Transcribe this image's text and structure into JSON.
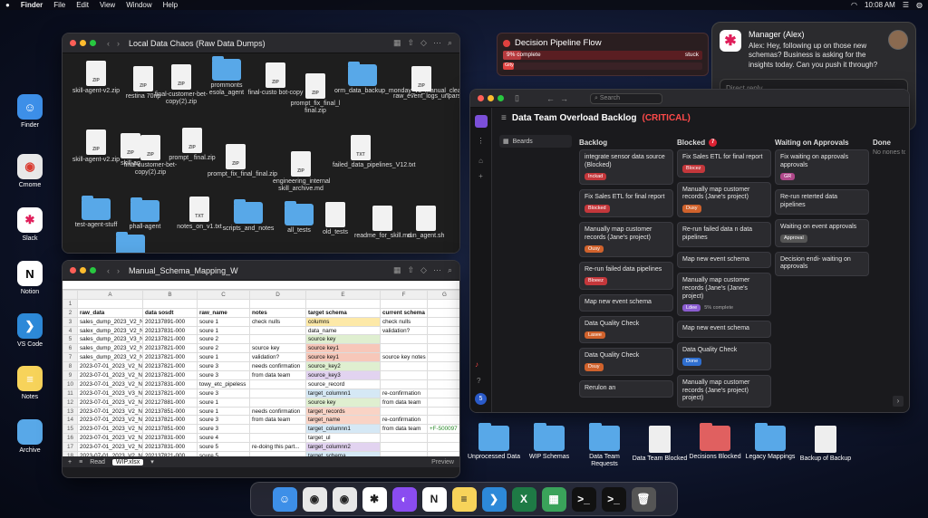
{
  "menubar": {
    "app": "Finder",
    "items": [
      "File",
      "Edit",
      "View",
      "Window",
      "Help"
    ],
    "clock": "10:08 AM"
  },
  "left_dock": [
    {
      "label": "Finder",
      "icon": "finder-icon",
      "color": "#3d8fe8"
    },
    {
      "label": "Cmome",
      "icon": "chrome-icon",
      "color": "#e8e8e8"
    },
    {
      "label": "Slack",
      "icon": "slack-icon",
      "color": "#ffffff"
    },
    {
      "label": "Notion",
      "icon": "notion-icon",
      "color": "#ffffff"
    },
    {
      "label": "VS Code",
      "icon": "vscode-icon",
      "color": "#2d89d8"
    },
    {
      "label": "Notes",
      "icon": "notes-icon",
      "color": "#f7d35a"
    },
    {
      "label": "Archive",
      "icon": "folder-icon",
      "color": "#58a8e8"
    }
  ],
  "finder": {
    "title": "Local Data Chaos (Raw Data Dumps)",
    "items": [
      {
        "label": "skill-agent-v2.zip",
        "kind": "zip"
      },
      {
        "label": "restina 70np",
        "kind": "zip"
      },
      {
        "label": "final-customer-bet-copy(2).zip",
        "kind": "zip"
      },
      {
        "label": "prommonts esola_agent",
        "kind": "folder"
      },
      {
        "label": "final-custo bot-copy",
        "kind": "zip"
      },
      {
        "label": "prompt_fix_final_l final.zip",
        "kind": "zip"
      },
      {
        "label": "orm_data_backup_monday_v3_manual_clean.xlsx",
        "kind": "folder"
      },
      {
        "label": "raw_event_logs_unparsed.json",
        "kind": "zip"
      },
      {
        "label": "skill-agent-v2.zip",
        "kind": "zip"
      },
      {
        "label": "skill-ag",
        "kind": "zip"
      },
      {
        "label": "final-customer-bet-copy(2).zip",
        "kind": "zip"
      },
      {
        "label": "prompt_ final.zip",
        "kind": "zip"
      },
      {
        "label": "prompt_fix_final_final.zip",
        "kind": "zip"
      },
      {
        "label": "engineering_internal skill_archive.md",
        "kind": "zip"
      },
      {
        "label": "failed_data_pipelines_V12.txt",
        "kind": "txt"
      },
      {
        "label": "test-agent-stuff",
        "kind": "folder"
      },
      {
        "label": "phall-agent",
        "kind": "folder"
      },
      {
        "label": "notes_on_v1.txt",
        "kind": "txt"
      },
      {
        "label": "scripts_and_notes",
        "kind": "folder"
      },
      {
        "label": "all_tests",
        "kind": "folder"
      },
      {
        "label": "old_tests",
        "kind": "doc"
      },
      {
        "label": "readme_for_skill.md",
        "kind": "doc"
      },
      {
        "label": "run_agent.sh",
        "kind": "doc"
      },
      {
        "label": "prompt_fi",
        "kind": "folder"
      }
    ]
  },
  "sheet": {
    "title": "Manual_Schema_Mapping_W",
    "col_letters": [
      "",
      "A",
      "B",
      "C",
      "D",
      "E",
      "F",
      "G"
    ],
    "headers": [
      "raw_data",
      "data sosdt",
      "raw_name",
      "notes",
      "target schema",
      "current schema",
      ""
    ],
    "rows": [
      [
        "sales_dump_2023_V2_N",
        "202137891-000",
        "soure 1",
        "check nulls",
        "columns",
        "check nulls",
        ""
      ],
      [
        "salex_dump_2023_V2_N",
        "202137831-000",
        "soure 1",
        "",
        "data_name",
        "validation?",
        ""
      ],
      [
        "sales_dump_2023_V3_N",
        "202137821-000",
        "soure 2",
        "",
        "source key",
        "",
        ""
      ],
      [
        "sales_dump_2023_V2_N",
        "202137821-000",
        "soure 2",
        "source key",
        "source key1",
        "",
        ""
      ],
      [
        "sales_dump_2023_V2_N",
        "202137821-000",
        "soure 1",
        "validation?",
        "source key1",
        "source key notes",
        ""
      ],
      [
        "2023-07-01_2023_V2_N",
        "202137821-000",
        "soure 3",
        "needs confirmation",
        "source_key2",
        "",
        ""
      ],
      [
        "2023-07-01_2023_V2_N",
        "202137821-000",
        "soure 3",
        "from data team",
        "source_key3",
        "",
        ""
      ],
      [
        "2023-07-01_2023_V2_N",
        "202137831-000",
        "towy_etc_pipeless",
        "",
        "source_record",
        "",
        ""
      ],
      [
        "2023-07-01_2023_V3_N",
        "202137821-000",
        "soure 3",
        "",
        "target_columnn1",
        "re-confirmation",
        ""
      ],
      [
        "2023-07-01_2023_V2_N",
        "202127881-000",
        "soure 1",
        "",
        "source key",
        "from data team",
        ""
      ],
      [
        "2023-07-01_2023_V2_N",
        "202137851-000",
        "soure 1",
        "needs confirmation",
        "target_records",
        "",
        ""
      ],
      [
        "2023-07-01_2023_V2_N",
        "202137821-000",
        "soure 3",
        "from data team",
        "target_name",
        "re-confirmation",
        ""
      ],
      [
        "2023-07-01_2023_V2_N",
        "202137851-000",
        "soure 3",
        "",
        "target_columnn1",
        "from data team",
        "+F-500097"
      ],
      [
        "2023-07-01_2023_V2_N",
        "202137831-000",
        "soure 4",
        "",
        "target_ul",
        "",
        ""
      ],
      [
        "2023-07-01_2023_V2_N",
        "202137831-000",
        "soure 5",
        "re-doing this part...",
        "target_columnn2",
        "",
        ""
      ],
      [
        "2023-07-01_2023_V2_N",
        "202137821-000",
        "soure 5",
        "",
        "target_schema",
        "",
        ""
      ]
    ],
    "tabs": [
      "Read",
      "WIP.xlsx"
    ],
    "preview": "Preview"
  },
  "pipeline": {
    "title": "Decision Pipeline Flow",
    "progress_label": "9% complete",
    "progress": 0.09,
    "status": "stuck",
    "small": "Gity"
  },
  "manager": {
    "name": "Manager (Alex)",
    "message": "Alex: Hey, following up on those new schemas? Business is asking for the insights today. Can you push it through?",
    "reply_placeholder": "Direct reply"
  },
  "backlog": {
    "title": "Data Team Overload Backlog",
    "critical": "(CRITICAL)",
    "search": "Search",
    "sidebar_label": "Beards",
    "notif_count": "5",
    "columns": [
      {
        "name": "Backlog",
        "badge": "",
        "cards": [
          {
            "text": "integrate sensor data source (Blocked)",
            "tag": "Inckad",
            "tagcolor": "#c4373b"
          },
          {
            "text": "Fix Sales ETL for final report",
            "tag": "Blocked",
            "tagcolor": "#c4373b"
          },
          {
            "text": "Manually map customer records (Jane's project)",
            "tag": "Ousy",
            "tagcolor": "#d0622c"
          },
          {
            "text": "Re-run failed data pipelines",
            "tag": "Bloeez",
            "tagcolor": "#c4373b"
          },
          {
            "text": "Map new event schema",
            "tag": "",
            "tagcolor": ""
          },
          {
            "text": "Data Quality Check",
            "tag": "Lasee",
            "tagcolor": "#d0622c"
          },
          {
            "text": "Data Quality Check",
            "tag": "Dsuy",
            "tagcolor": "#d0622c"
          },
          {
            "text": "Rerulon an",
            "tag": "",
            "tagcolor": ""
          }
        ]
      },
      {
        "name": "Blocked",
        "badge": "7",
        "cards": [
          {
            "text": "Fix Sales ETL for final report",
            "tag": "Blocez",
            "tagcolor": "#c4373b"
          },
          {
            "text": "Manually map customer records (Jane's project)",
            "tag": "Dusy",
            "tagcolor": "#d0622c"
          },
          {
            "text": "Re-run failed data n data pipelines",
            "tag": "",
            "tagcolor": ""
          },
          {
            "text": "Map new event schema",
            "tag": "",
            "tagcolor": ""
          },
          {
            "text": "Manually map customer records (Jane's (Jane's project)",
            "tag": "Ldee",
            "tagcolor": "#8a5cd0",
            "extra": "5% complete"
          },
          {
            "text": "Map new event schema",
            "tag": "",
            "tagcolor": ""
          },
          {
            "text": "Data Quality Check",
            "tag": "Done",
            "tagcolor": "#2f6fd0"
          },
          {
            "text": "Manually map customer records (Jane's project) project)",
            "tag": "",
            "tagcolor": ""
          }
        ]
      },
      {
        "name": "Waiting on Approvals",
        "badge": "",
        "cards": [
          {
            "text": "Fix waiting on approvals approvals",
            "tag": "GR",
            "tagcolor": "#b0488a"
          },
          {
            "text": "Re-run reterted data pipelines",
            "tag": "",
            "tagcolor": ""
          },
          {
            "text": "Waiting on event approvals",
            "tag": "Approval",
            "tagcolor": "#555"
          },
          {
            "text": "Decision endi- waiting on approvals",
            "tag": "",
            "tagcolor": ""
          }
        ]
      },
      {
        "name": "Done",
        "badge": "",
        "cards": [],
        "empty": "No nones to"
      }
    ]
  },
  "desktop_folders": [
    {
      "label": "Unprocessed Data",
      "color": "#58a8e8",
      "kind": "folder"
    },
    {
      "label": "WIP Schemas",
      "color": "#58a8e8",
      "kind": "folder"
    },
    {
      "label": "Data Team Requests",
      "color": "#58a8e8",
      "kind": "folder"
    },
    {
      "label": "Data Team Blocked",
      "color": "#eeeeee",
      "kind": "doc"
    },
    {
      "label": "Decisions Blocked",
      "color": "#e06060",
      "kind": "folder"
    },
    {
      "label": "Legacy Mappings",
      "color": "#58a8e8",
      "kind": "folder"
    },
    {
      "label": "Backup of Backup",
      "color": "#eeeeee",
      "kind": "doc"
    }
  ],
  "dock": [
    {
      "icon": "finder-icon",
      "color": "#3d8fe8",
      "glyph": "☺"
    },
    {
      "icon": "chrome-icon",
      "color": "#e8e8e8",
      "glyph": "◉"
    },
    {
      "icon": "chrome-icon",
      "color": "#e8e8e8",
      "glyph": "◉"
    },
    {
      "icon": "slack-icon",
      "color": "#ffffff",
      "glyph": "✱"
    },
    {
      "icon": "messenger-icon",
      "color": "#8a4cf0",
      "glyph": "◐"
    },
    {
      "icon": "notion-icon",
      "color": "#ffffff",
      "glyph": "N"
    },
    {
      "icon": "notes-icon",
      "color": "#f7d35a",
      "glyph": "≡"
    },
    {
      "icon": "vscode-icon",
      "color": "#2d89d8",
      "glyph": "❯"
    },
    {
      "icon": "excel-icon",
      "color": "#1e7a45",
      "glyph": "X"
    },
    {
      "icon": "sheets-icon",
      "color": "#3aa35a",
      "glyph": "▦"
    },
    {
      "icon": "terminal-icon",
      "color": "#111111",
      "glyph": ">_"
    },
    {
      "icon": "terminal-icon",
      "color": "#111111",
      "glyph": ">_"
    },
    {
      "icon": "trash-icon",
      "color": "#555555",
      "glyph": "🗑"
    }
  ]
}
